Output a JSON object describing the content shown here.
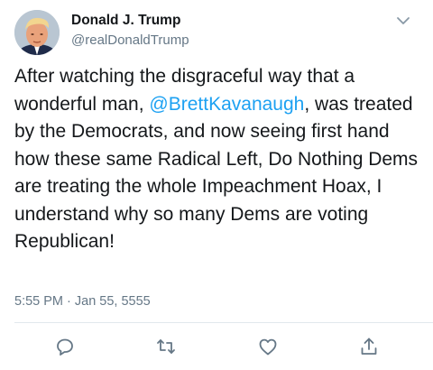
{
  "author": {
    "display_name": "Donald J. Trump",
    "handle": "@realDonaldTrump"
  },
  "tweet": {
    "text_before_mention": "After watching the disgraceful way that a wonderful man, ",
    "mention": "@BrettKavanaugh",
    "text_after_mention": ", was treated by the Democrats, and now seeing first hand how these same Radical Left, Do Nothing Dems are treating the whole Impeachment Hoax, I understand why so many Dems are voting Republican!",
    "timestamp": "5:55 PM · Jan 55, 5555"
  },
  "icons": {
    "menu": "chevron-down-icon",
    "reply": "reply-icon",
    "retweet": "retweet-icon",
    "like": "heart-icon",
    "share": "share-icon"
  },
  "colors": {
    "text": "#14171a",
    "secondary": "#657786",
    "mention": "#1da1f2",
    "divider": "#e1e8ed"
  }
}
